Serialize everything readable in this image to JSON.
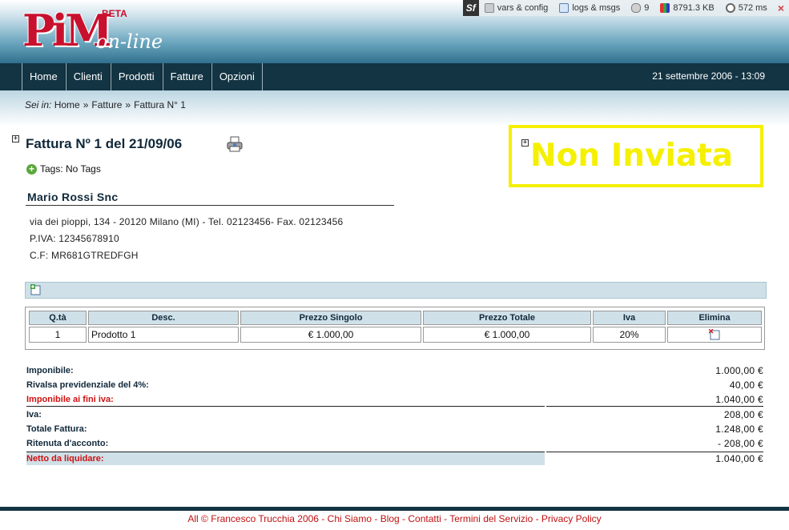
{
  "app": {
    "logo_main": "PiM",
    "logo_sub": "on-line",
    "logo_badge": "BETA"
  },
  "debug": {
    "sf": "Sf",
    "vars": "vars & config",
    "logs": "logs & msgs",
    "db_queries": "9",
    "memory": "8791.3 KB",
    "time": "572 ms",
    "close": "×"
  },
  "nav": {
    "items": [
      {
        "label": "Home"
      },
      {
        "label": "Clienti"
      },
      {
        "label": "Prodotti"
      },
      {
        "label": "Fatture"
      },
      {
        "label": "Opzioni"
      }
    ],
    "date": "21 settembre 2006 - 13:09"
  },
  "breadcrumb": {
    "prefix": "Sei in:",
    "items": [
      "Home",
      "Fatture",
      "Fattura N° 1"
    ],
    "sep": "»"
  },
  "invoice": {
    "title": "Fattura Nº 1 del 21/09/06",
    "tags": "Tags: No Tags",
    "status": "Non Inviata"
  },
  "client": {
    "name": "Mario Rossi Snc",
    "address": "via dei pioppi, 134 - 20120 Milano (MI) - Tel. 02123456- Fax. 02123456",
    "piva": "P.IVA: 12345678910",
    "cf": "C.F: MR681GTREDFGH"
  },
  "table": {
    "headers": [
      "Q.tà",
      "Desc.",
      "Prezzo Singolo",
      "Prezzo Totale",
      "Iva",
      "Elimina"
    ],
    "rows": [
      {
        "qty": "1",
        "desc": "Prodotto 1",
        "unit": "€ 1.000,00",
        "total": "€ 1.000,00",
        "iva": "20%"
      }
    ]
  },
  "totals": [
    {
      "label": "Imponibile:",
      "value": "1.000,00 €"
    },
    {
      "label": "Rivalsa previdenziale del 4%:",
      "value": "40,00 €"
    },
    {
      "label": "Imponibile ai fini iva:",
      "value": "1.040,00 €"
    },
    {
      "label": "Iva:",
      "value": "208,00 €"
    },
    {
      "label": "Totale Fattura:",
      "value": "1.248,00 €"
    },
    {
      "label": "Ritenuta d'acconto:",
      "value": "- 208,00 €"
    },
    {
      "label": "Netto da liquidare:",
      "value": "1.040,00 €"
    }
  ],
  "footer": {
    "copyright": "All © Francesco Trucchia 2006",
    "links": [
      "Chi Siamo",
      "Blog",
      "Contatti",
      "Termini del Servizio",
      "Privacy Policy"
    ],
    "sep": " - "
  },
  "colors": {
    "nav_bg": "#133443",
    "status": "#f5f000",
    "accent_red": "#d01010",
    "header_blue": "#2e6f8c"
  }
}
